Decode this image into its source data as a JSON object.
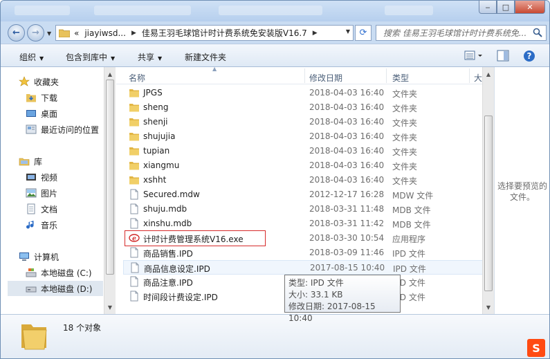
{
  "window": {
    "caption_buttons": {
      "minimize": "‒",
      "maximize": "□",
      "close": "✕"
    }
  },
  "nav": {
    "back": "←",
    "forward": "→",
    "address": {
      "prefix": "«",
      "segments": [
        "jiayiwsd...",
        "佳易王羽毛球馆计时计费系统免安装版V16.7"
      ]
    },
    "search_placeholder": "搜索 佳易王羽毛球馆计时计费系统免..."
  },
  "toolbar": {
    "organize": "组织",
    "include_in_library": "包含到库中",
    "share": "共享",
    "new_folder": "新建文件夹"
  },
  "sidebar": {
    "favorites": {
      "label": "收藏夹",
      "items": [
        {
          "label": "下载",
          "icon": "download-folder-icon"
        },
        {
          "label": "桌面",
          "icon": "desktop-icon"
        },
        {
          "label": "最近访问的位置",
          "icon": "recent-places-icon"
        }
      ]
    },
    "libraries": {
      "label": "库",
      "items": [
        {
          "label": "视频",
          "icon": "video-library-icon"
        },
        {
          "label": "图片",
          "icon": "picture-library-icon"
        },
        {
          "label": "文档",
          "icon": "document-library-icon"
        },
        {
          "label": "音乐",
          "icon": "music-library-icon"
        }
      ]
    },
    "computer": {
      "label": "计算机",
      "items": [
        {
          "label": "本地磁盘 (C:)",
          "icon": "drive-c-icon"
        },
        {
          "label": "本地磁盘 (D:)",
          "icon": "drive-d-icon",
          "selected": true
        }
      ]
    }
  },
  "columns": {
    "name": "名称",
    "date": "修改日期",
    "type": "类型",
    "size": "大"
  },
  "files": [
    {
      "name": "JPGS",
      "date": "2018-04-03 16:40",
      "type": "文件夹",
      "icon": "folder-icon"
    },
    {
      "name": "sheng",
      "date": "2018-04-03 16:40",
      "type": "文件夹",
      "icon": "folder-icon"
    },
    {
      "name": "shenji",
      "date": "2018-04-03 16:40",
      "type": "文件夹",
      "icon": "folder-icon"
    },
    {
      "name": "shujujia",
      "date": "2018-04-03 16:40",
      "type": "文件夹",
      "icon": "folder-icon"
    },
    {
      "name": "tupian",
      "date": "2018-04-03 16:40",
      "type": "文件夹",
      "icon": "folder-icon"
    },
    {
      "name": "xiangmu",
      "date": "2018-04-03 16:40",
      "type": "文件夹",
      "icon": "folder-icon"
    },
    {
      "name": "xshht",
      "date": "2018-04-03 16:40",
      "type": "文件夹",
      "icon": "folder-icon"
    },
    {
      "name": "Secured.mdw",
      "date": "2012-12-17 16:28",
      "type": "MDW 文件",
      "icon": "file-icon"
    },
    {
      "name": "shuju.mdb",
      "date": "2018-03-31 11:48",
      "type": "MDB 文件",
      "icon": "file-icon"
    },
    {
      "name": "xinshu.mdb",
      "date": "2018-03-31 11:42",
      "type": "MDB 文件",
      "icon": "file-icon"
    },
    {
      "name": "计时计费管理系统V16.exe",
      "date": "2018-03-30 10:54",
      "type": "应用程序",
      "icon": "app-exe-icon",
      "highlighted": true
    },
    {
      "name": "商品销售.IPD",
      "date": "2018-03-09 11:46",
      "type": "IPD 文件",
      "icon": "file-icon"
    },
    {
      "name": "商品信息设定.IPD",
      "date": "2017-08-15 10:40",
      "type": "IPD 文件",
      "icon": "file-icon",
      "hover": true
    },
    {
      "name": "商品注意.IPD",
      "date": "",
      "type": "IPD 文件",
      "icon": "file-icon"
    },
    {
      "name": "时间段计费设定.IPD",
      "date": "",
      "type": "IPD 文件",
      "icon": "file-icon"
    }
  ],
  "tooltip": {
    "type_line": "类型: IPD 文件",
    "size_line": "大小: 33.1 KB",
    "date_line": "修改日期: 2017-08-15 10:40"
  },
  "preview": {
    "text": "选择要预览的文件。"
  },
  "details": {
    "count": "18 个对象"
  },
  "colors": {
    "highlight_box": "#d62a2a",
    "window_frame": "#c9dcf2",
    "close_button": "#c84a33"
  }
}
